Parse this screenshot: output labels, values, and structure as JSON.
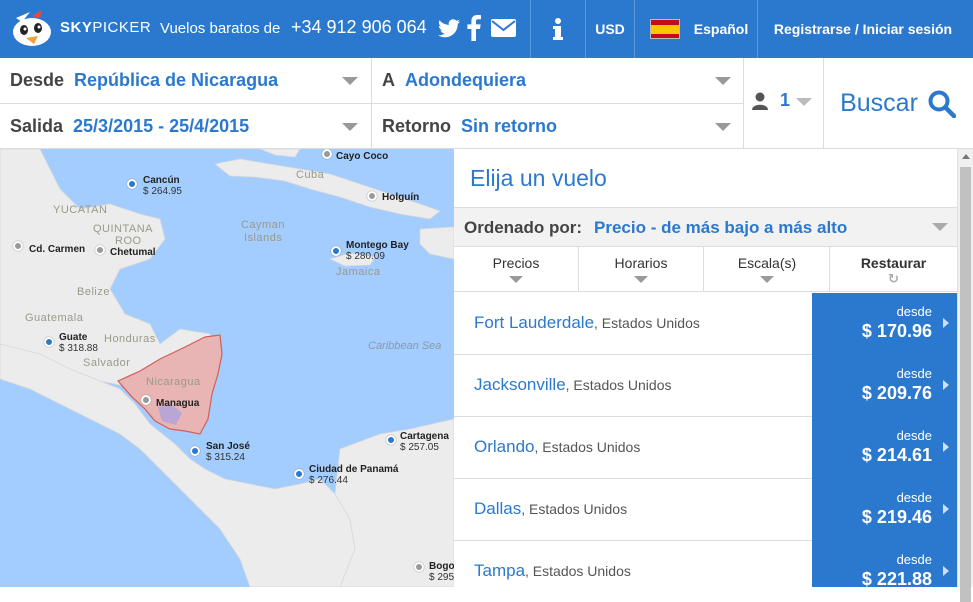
{
  "header": {
    "brand_sky": "SKY",
    "brand_picker": "PICKER",
    "tagline": "Vuelos baratos de",
    "phone": "+34 912 906 064",
    "icons": [
      "twitter-icon",
      "facebook-icon",
      "mail-icon",
      "info-icon"
    ],
    "currency": "USD",
    "language": "Español",
    "auth": "Registrarse / Iniciar sesión"
  },
  "search": {
    "from_label": "Desde",
    "from_value": "República de Nicaragua",
    "to_label": "A",
    "to_value": "Adondequiera",
    "depart_label": "Salida",
    "depart_value": "25/3/2015 - 25/4/2015",
    "return_label": "Retorno",
    "return_value": "Sin retorno",
    "passengers": "1",
    "search_button": "Buscar"
  },
  "map": {
    "cities": [
      {
        "name": "Cayo Coco",
        "price": ""
      },
      {
        "name": "Cancún",
        "price": "$ 264.95"
      },
      {
        "name": "Holguín",
        "price": ""
      },
      {
        "name": "Cd. Carmen",
        "price": ""
      },
      {
        "name": "Chetumal",
        "price": ""
      },
      {
        "name": "Montego Bay",
        "price": "$ 280.09"
      },
      {
        "name": "Guate",
        "price": "$ 318.88"
      },
      {
        "name": "Managua",
        "price": ""
      },
      {
        "name": "San José",
        "price": "$ 315.24"
      },
      {
        "name": "Cartagena",
        "price": "$ 257.05"
      },
      {
        "name": "Ciudad de Panamá",
        "price": "$ 276.44"
      },
      {
        "name": "Bogo",
        "price": "$ 295"
      }
    ],
    "labels": {
      "sea": "Caribbean Sea",
      "yucatan": "YUCATAN",
      "quintana": "QUINTANA",
      "roo": "ROO",
      "belize": "Belize",
      "guatemala": "Guatemala",
      "honduras": "Honduras",
      "salvador": "Salvador",
      "nicaragua": "Nicaragua",
      "cuba": "Cuba",
      "cayman": "Cayman",
      "islands": "Islands",
      "jamaica": "Jamaica"
    }
  },
  "results": {
    "title": "Elija un vuelo",
    "sort_label": "Ordenado por:",
    "sort_value": "Precio - de más bajo a más alto",
    "tabs": [
      "Precios",
      "Horarios",
      "Escala(s)",
      "Restaurar"
    ],
    "from_word": "desde",
    "flights": [
      {
        "city": "Fort Lauderdale",
        "country": ", Estados Unidos",
        "price": "$ 170.96"
      },
      {
        "city": "Jacksonville",
        "country": ", Estados Unidos",
        "price": "$ 209.76"
      },
      {
        "city": "Orlando",
        "country": ", Estados Unidos",
        "price": "$ 214.61"
      },
      {
        "city": "Dallas",
        "country": ", Estados Unidos",
        "price": "$ 219.46"
      },
      {
        "city": "Tampa",
        "country": ", Estados Unidos",
        "price": "$ 221.88"
      }
    ]
  },
  "colors": {
    "brand_blue": "#2b79cf",
    "ocean": "#a3ccff",
    "land": "#ececec",
    "highlight": "#e8b4b4"
  }
}
